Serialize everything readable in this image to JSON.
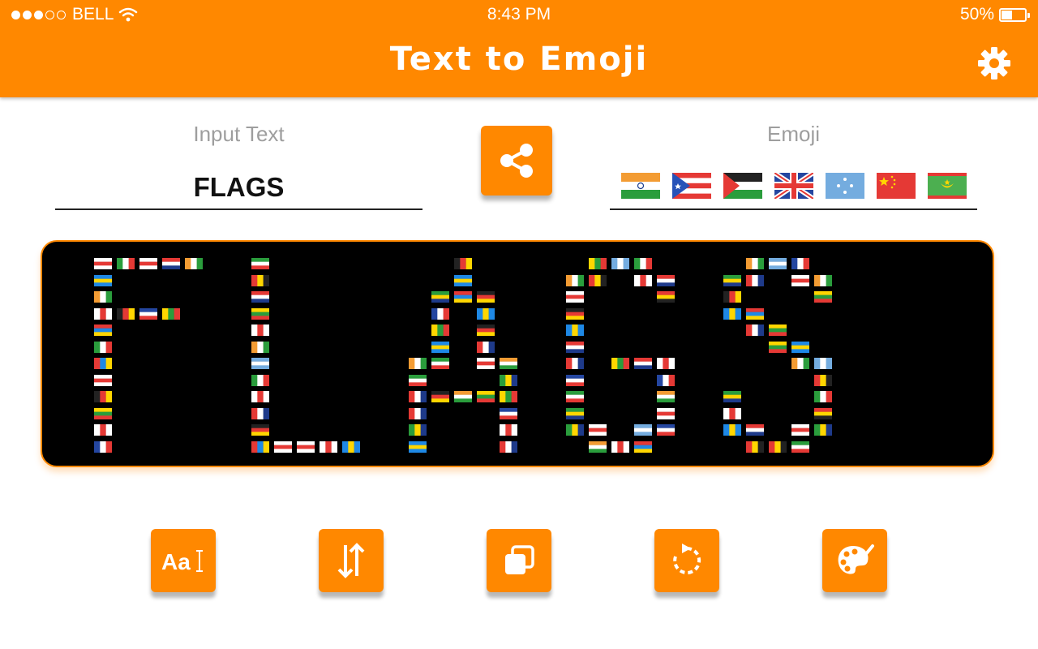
{
  "status_bar": {
    "carrier": "BELL",
    "time": "8:43 PM",
    "battery": "50%",
    "battery_level": 0.5
  },
  "header": {
    "title": "Text to Emoji",
    "settings_icon": "gear-icon"
  },
  "input": {
    "label": "Input Text",
    "value": "FLAGS"
  },
  "share": {
    "icon": "share-icon"
  },
  "emoji": {
    "label": "Emoji",
    "flags": [
      "india-flag",
      "puerto-rico-flag",
      "palestine-flag",
      "united-kingdom-flag",
      "micronesia-flag",
      "china-flag",
      "mauritania-flag"
    ]
  },
  "preview": {
    "text": "FLAGS",
    "content": "flag-emoji-art"
  },
  "tools": [
    "font-icon",
    "sort-arrows-icon",
    "duplicate-icon",
    "refresh-icon",
    "palette-icon"
  ],
  "colors": {
    "accent": "#ff8800",
    "canvas": "#000000"
  }
}
